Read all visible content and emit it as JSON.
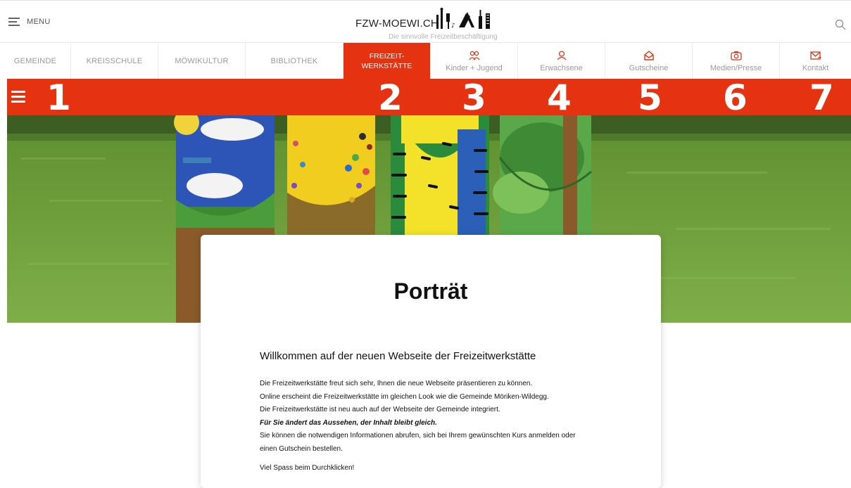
{
  "header": {
    "menu_label": "MENU",
    "brand": "FZW-MOEWI.CH",
    "tagline": "Die sinnvolle Freizeitbeschäftigung"
  },
  "nav": [
    {
      "label": "GEMEINDE"
    },
    {
      "label": "KREISSCHULE"
    },
    {
      "label": "MÖWIKULTUR"
    },
    {
      "label": "BIBLIOTHEK"
    },
    {
      "line1": "FREIZEIT-",
      "line2": "WERKSTÄTTE",
      "active": true
    },
    {
      "label": "Kinder + Jugend",
      "icon": "people-icon"
    },
    {
      "label": "Erwachsene",
      "icon": "adult-icon"
    },
    {
      "label": "Gutscheine",
      "icon": "voucher-icon"
    },
    {
      "label": "Medien/Presse",
      "icon": "camera-icon"
    },
    {
      "label": "Kontakt",
      "icon": "mail-icon"
    }
  ],
  "numbers": [
    "1",
    "2",
    "3",
    "4",
    "5",
    "6",
    "7"
  ],
  "content": {
    "title": "Porträt",
    "heading": "Willkommen auf der neuen Webseite der Freizeitwerkstätte",
    "paragraphs": [
      "Die Freizeitwerkstätte freut sich sehr, Ihnen die neue Webseite präsentieren zu können.",
      "Online erscheint die Freizeitwerkstätte im gleichen Look wie die Gemeinde Möriken-Wildegg.",
      "Die Freizeitwerkstätte ist neu auch auf der Webseite der Gemeinde integriert.",
      "Für Sie ändert das Aussehen, der Inhalt bleibt gleich.",
      "Sie können die notwendigen Informationen abrufen, sich bei Ihrem gewünschten Kurs anmelden oder",
      "einen Gutschein bestellen.",
      "Viel Spass beim Durchklicken!"
    ]
  },
  "colors": {
    "accent": "#e53311",
    "nav_text": "#999999",
    "grass": "#6f9f3c"
  }
}
